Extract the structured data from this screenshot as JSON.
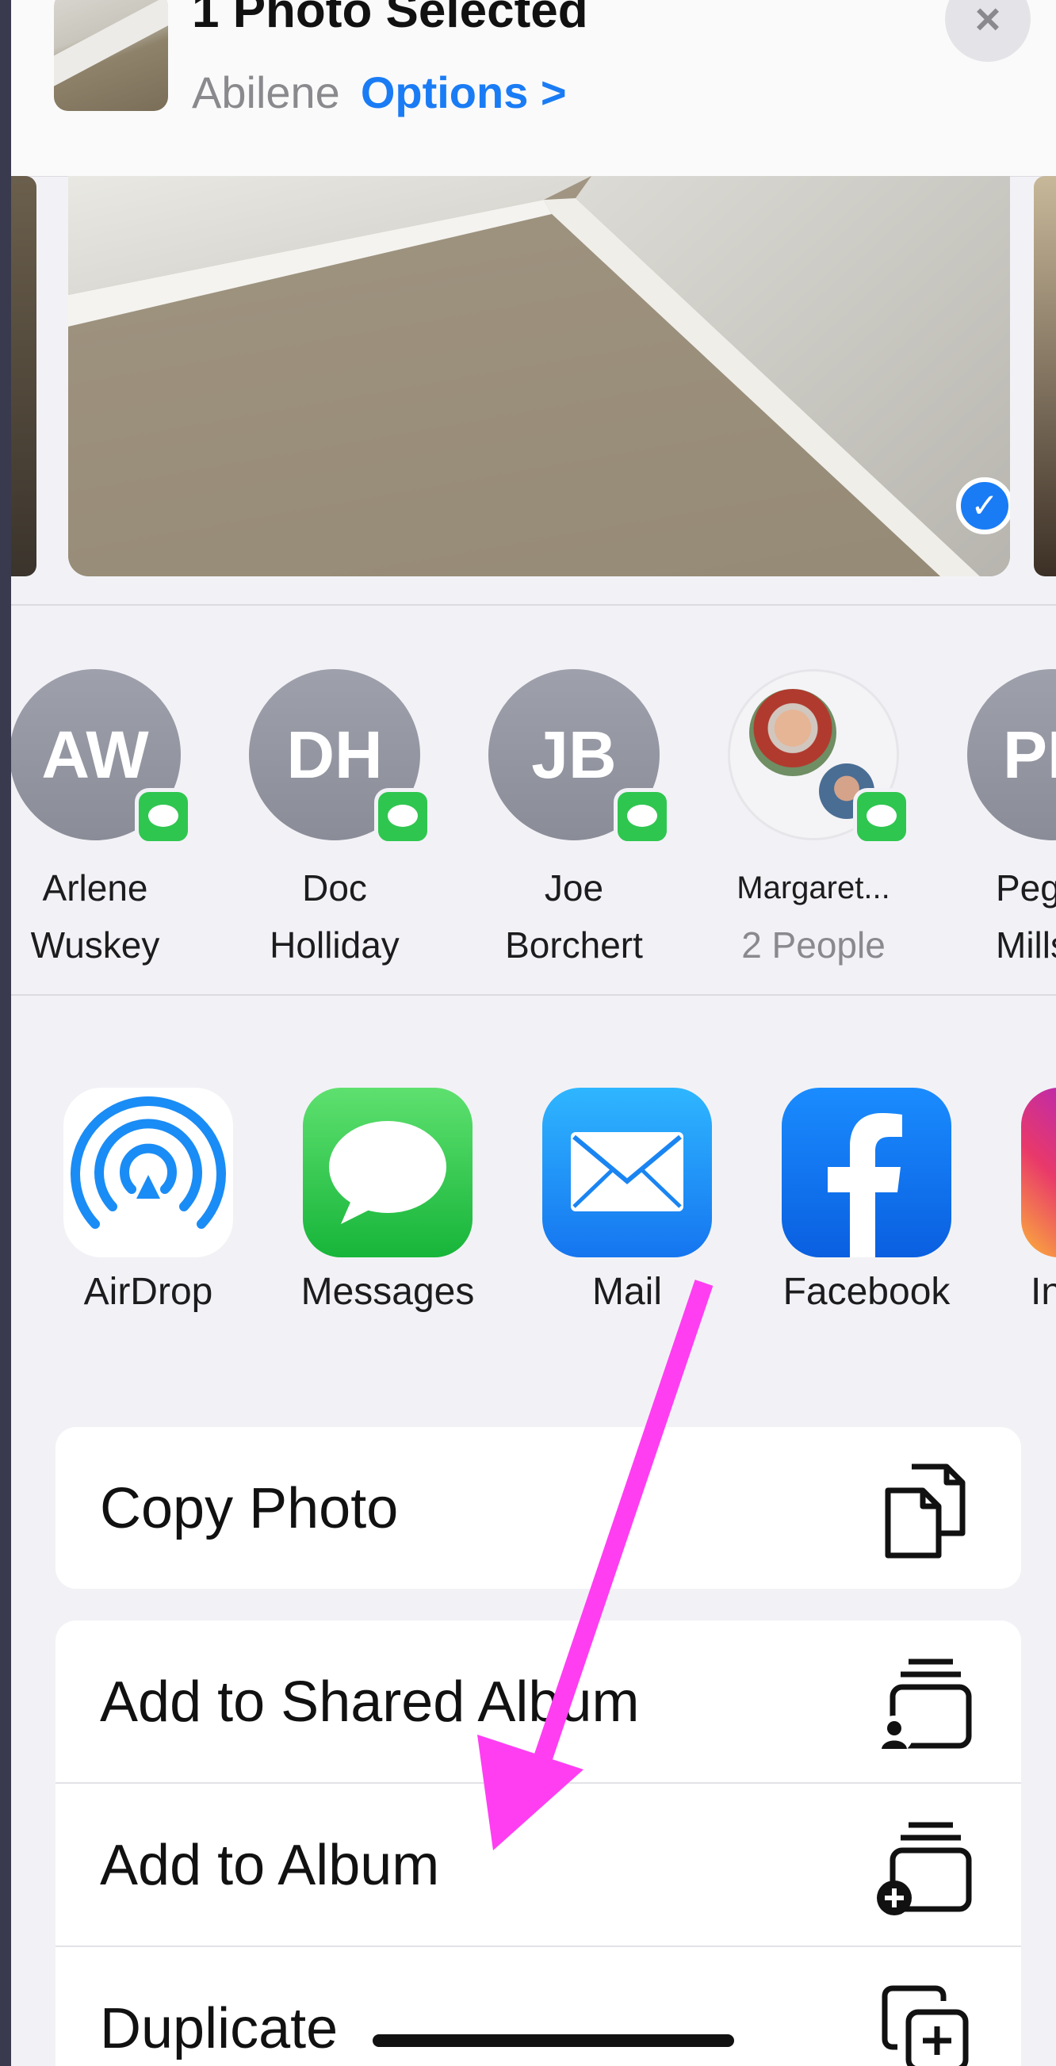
{
  "header": {
    "title": "1 Photo Selected",
    "location": "Abilene",
    "options_label": "Options >",
    "close_glyph": "×"
  },
  "people": [
    {
      "initials": "AW",
      "line1": "Arlene",
      "line2": "Wuskey"
    },
    {
      "initials": "DH",
      "line1": "Doc",
      "line2": "Holliday"
    },
    {
      "initials": "JB",
      "line1": "Joe",
      "line2": "Borchert"
    },
    {
      "initials": "",
      "line1": "Margaret...",
      "line2": "2 People"
    },
    {
      "initials": "PM",
      "line1": "Peg",
      "line2": "Millst"
    }
  ],
  "apps": [
    {
      "label": "AirDrop",
      "icon": "airdrop-icon"
    },
    {
      "label": "Messages",
      "icon": "messages-icon"
    },
    {
      "label": "Mail",
      "icon": "mail-icon"
    },
    {
      "label": "Facebook",
      "icon": "facebook-icon"
    },
    {
      "label": "Ins",
      "icon": "instagram-icon"
    }
  ],
  "actions": {
    "copy_photo": "Copy Photo",
    "add_shared_album": "Add to Shared Album",
    "add_album": "Add to Album",
    "duplicate": "Duplicate"
  },
  "colors": {
    "accent": "#1a7cf5",
    "annotation_arrow": "#ff3ef2",
    "sheet_bg": "#f2f2f6"
  }
}
